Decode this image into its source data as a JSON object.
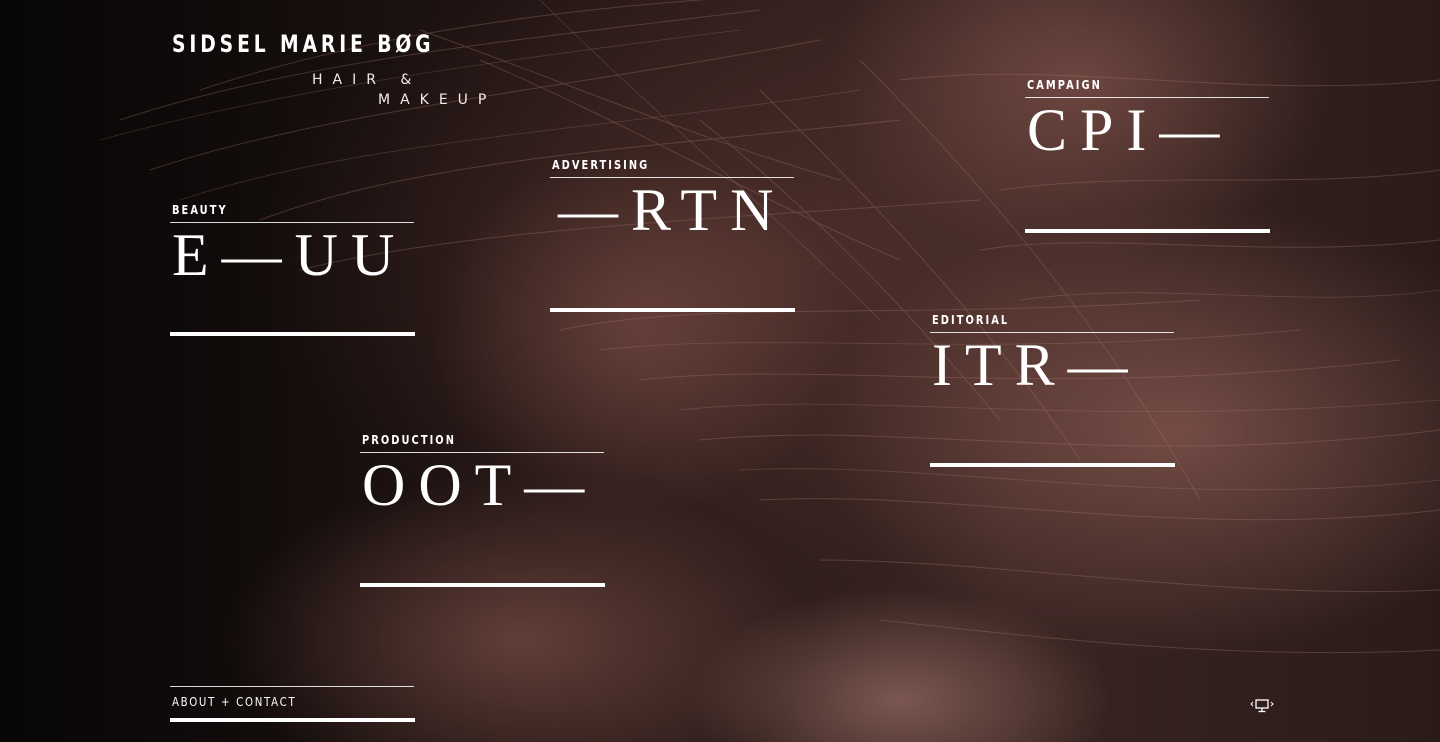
{
  "brand": {
    "name": "SIDSEL MARIE BØG",
    "subtitle_line1": "HAIR &",
    "subtitle_line2": "MAKEUP"
  },
  "categories": [
    {
      "label": "BEAUTY",
      "code": "E—UU"
    },
    {
      "label": "ADVERTISING",
      "code": "—RTN"
    },
    {
      "label": "CAMPAIGN",
      "code": "CPI—"
    },
    {
      "label": "EDITORIAL",
      "code": "ITR—"
    },
    {
      "label": "PRODUCTION",
      "code": "OOT—"
    }
  ],
  "footer": {
    "about_contact": "ABOUT + CONTACT"
  },
  "icons": {
    "fullscreen": "screen-icon"
  },
  "colors": {
    "text": "#ffffff",
    "background": "#0b0808",
    "tint": "#9a625a"
  }
}
